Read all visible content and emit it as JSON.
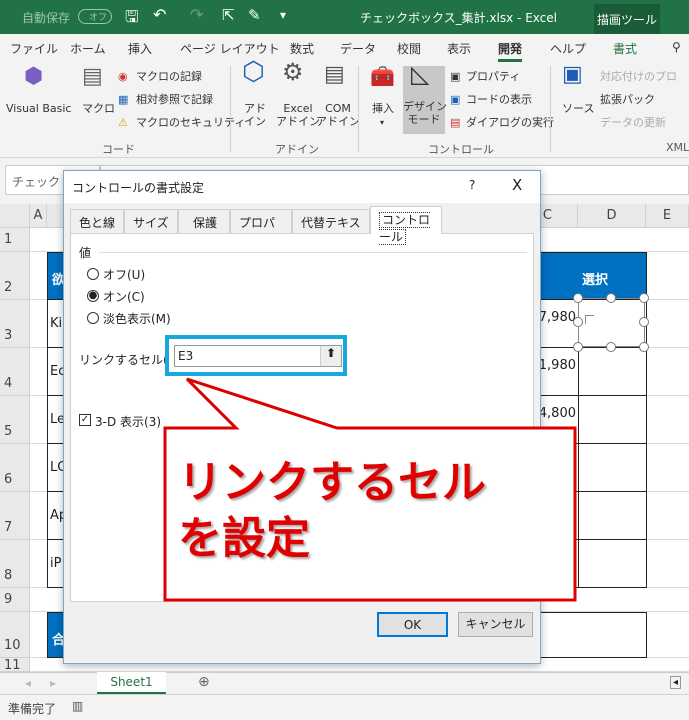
{
  "titlebar": {
    "autosave": "自動保存",
    "autosave_state": "オフ",
    "filename": "チェックボックス_集計.xlsx - Excel",
    "context_tab": "描画ツール"
  },
  "ribbon_tabs": [
    "ファイル",
    "ホーム",
    "挿入",
    "ページ レイアウト",
    "数式",
    "データ",
    "校閲",
    "表示",
    "開発",
    "ヘルプ",
    "書式"
  ],
  "active_tab": "開発",
  "ribbon": {
    "code": {
      "label": "コード",
      "visual_basic": "Visual Basic",
      "macro": "マクロ",
      "record": "マクロの記録",
      "relative": "相対参照で記録",
      "security": "マクロのセキュリティ"
    },
    "addins": {
      "label": "アドイン",
      "addin": "アド\nイン",
      "excel_addin": "Excel\nアドイン",
      "com_addin": "COM\nアドイン"
    },
    "controls": {
      "label": "コントロール",
      "insert": "挿入",
      "design_mode": "デザイン\nモード",
      "properties": "プロパティ",
      "view_code": "コードの表示",
      "run_dialog": "ダイアログの実行"
    },
    "xml": {
      "label": "XML",
      "source": "ソース",
      "map_props": "対応付けのプロ",
      "expansion": "拡張パック",
      "refresh": "データの更新"
    }
  },
  "namebox": "チェック",
  "columns": [
    "A",
    "C",
    "D",
    "E"
  ],
  "rows": [
    "1",
    "2",
    "3",
    "4",
    "5",
    "6",
    "7",
    "8",
    "9",
    "10",
    "11"
  ],
  "sheet": {
    "header_select": "選択",
    "b_header": "欲",
    "b": [
      "Ki",
      "Ec",
      "Le",
      "LC",
      "Ap",
      "iP"
    ],
    "c": [
      "7,980",
      "1,980",
      "4,800"
    ],
    "total": "合"
  },
  "dialog": {
    "title": "コントロールの書式設定",
    "help": "?",
    "close": "X",
    "tabs": [
      "色と線",
      "サイズ",
      "保護",
      "プロパティ",
      "代替テキスト",
      "コントロール"
    ],
    "active_tab": "コントロール",
    "value_label": "値",
    "options": [
      {
        "label": "オフ(U)",
        "checked": false
      },
      {
        "label": "オン(C)",
        "checked": true
      },
      {
        "label": "淡色表示(M)",
        "checked": false
      }
    ],
    "link_label": "リンクするセル(L):",
    "link_value": "E3",
    "threed_label": "3-D 表示(3)",
    "threed_checked": true,
    "ok": "OK",
    "cancel": "キャンセル"
  },
  "callout": {
    "line1": "リンクするセル",
    "line2": "を設定",
    "color": "#e00000",
    "highlight": "#1aa7e0"
  },
  "sheet_tab": "Sheet1",
  "status": "準備完了",
  "colors": {
    "excel_green": "#217346",
    "table_blue": "#0070c0"
  }
}
